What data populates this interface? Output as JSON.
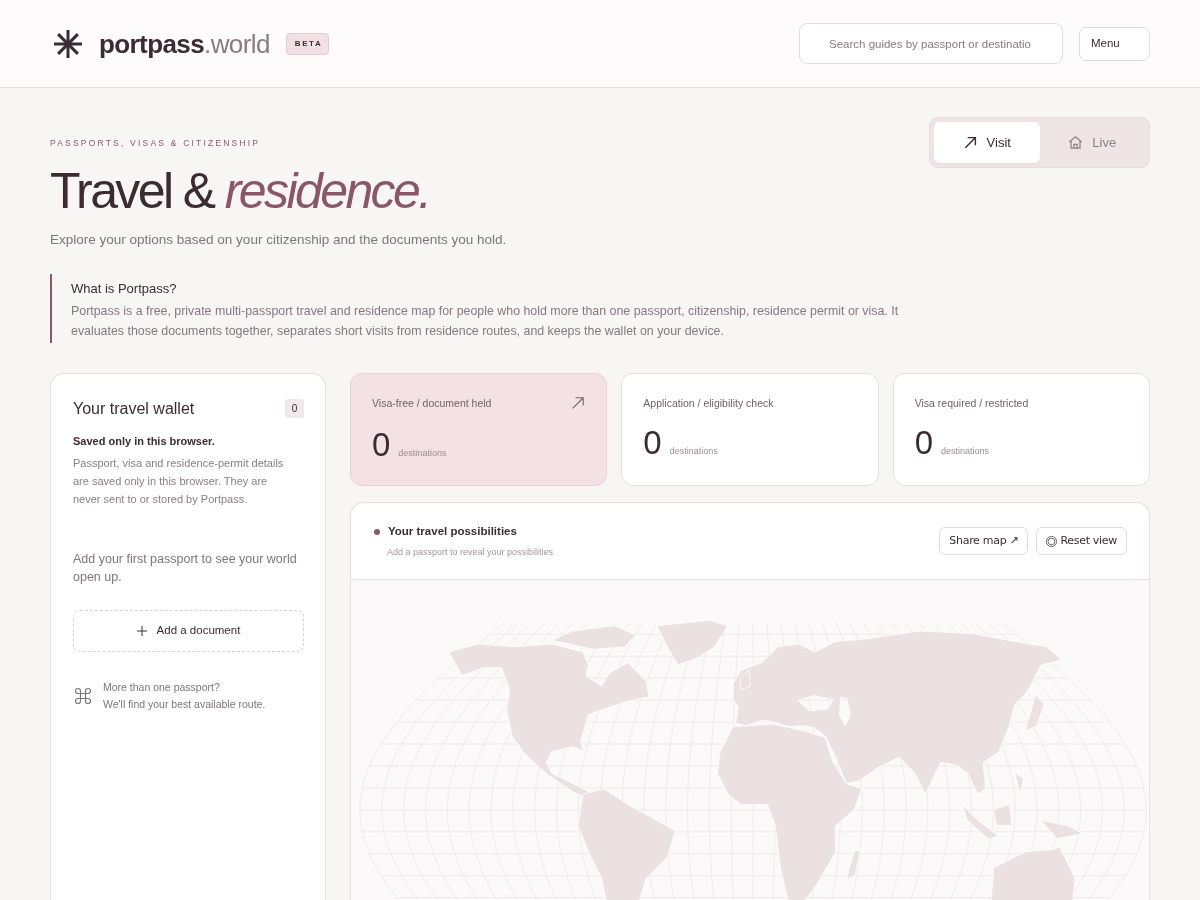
{
  "header": {
    "logo_text": "**portpass**.world",
    "badge": "BETA",
    "search": {
      "placeholder": "Search guides by passport or destinatio"
    },
    "menu_button": "Menu"
  },
  "hero": {
    "eyebrow": "PASSPORTS, VISAS & CITIZENSHIP",
    "title": "Travel & *residence.*",
    "subtitle": "Explore your options based on your citizenship and the documents you hold.",
    "mode_tabs": [
      {
        "label": "Visit",
        "selected": true
      },
      {
        "label": "Live",
        "selected": false
      }
    ]
  },
  "about": {
    "title": "What is Portpass?",
    "text": "Portpass is a free, private multi-passport travel and residence map for people who hold more than one passport, citizenship, residence permit or visa. It evaluates those documents together, separates short visits from residence routes, and keeps the wallet on your device."
  },
  "wallet": {
    "title": "Your travel wallet",
    "count": "0",
    "note_title": "Saved only in this browser.",
    "note_text": "Passport, visa and residence-permit details are saved only in this browser. They are never sent to or stored by Portpass.",
    "empty_text": "Add your first passport to see your world open up.",
    "add_button": "Add a document",
    "tip_lines": [
      "More than one passport?",
      "We'll find your best available route."
    ]
  },
  "stats": [
    {
      "label": "Visa-free / document held",
      "value": "0",
      "unit": "destinations",
      "selected": true
    },
    {
      "label": "Application / eligibility check",
      "value": "0",
      "unit": "destinations",
      "selected": false
    },
    {
      "label": "Visa required / restricted",
      "value": "0",
      "unit": "destinations",
      "selected": false
    }
  ],
  "map": {
    "title": "Your travel possibilities",
    "subtitle": "Add a passport to reveal your possibilities",
    "buttons": [
      {
        "label": "Share map ↗",
        "kind": "plain"
      },
      {
        "label": "Reset view",
        "kind": "icon"
      }
    ]
  }
}
